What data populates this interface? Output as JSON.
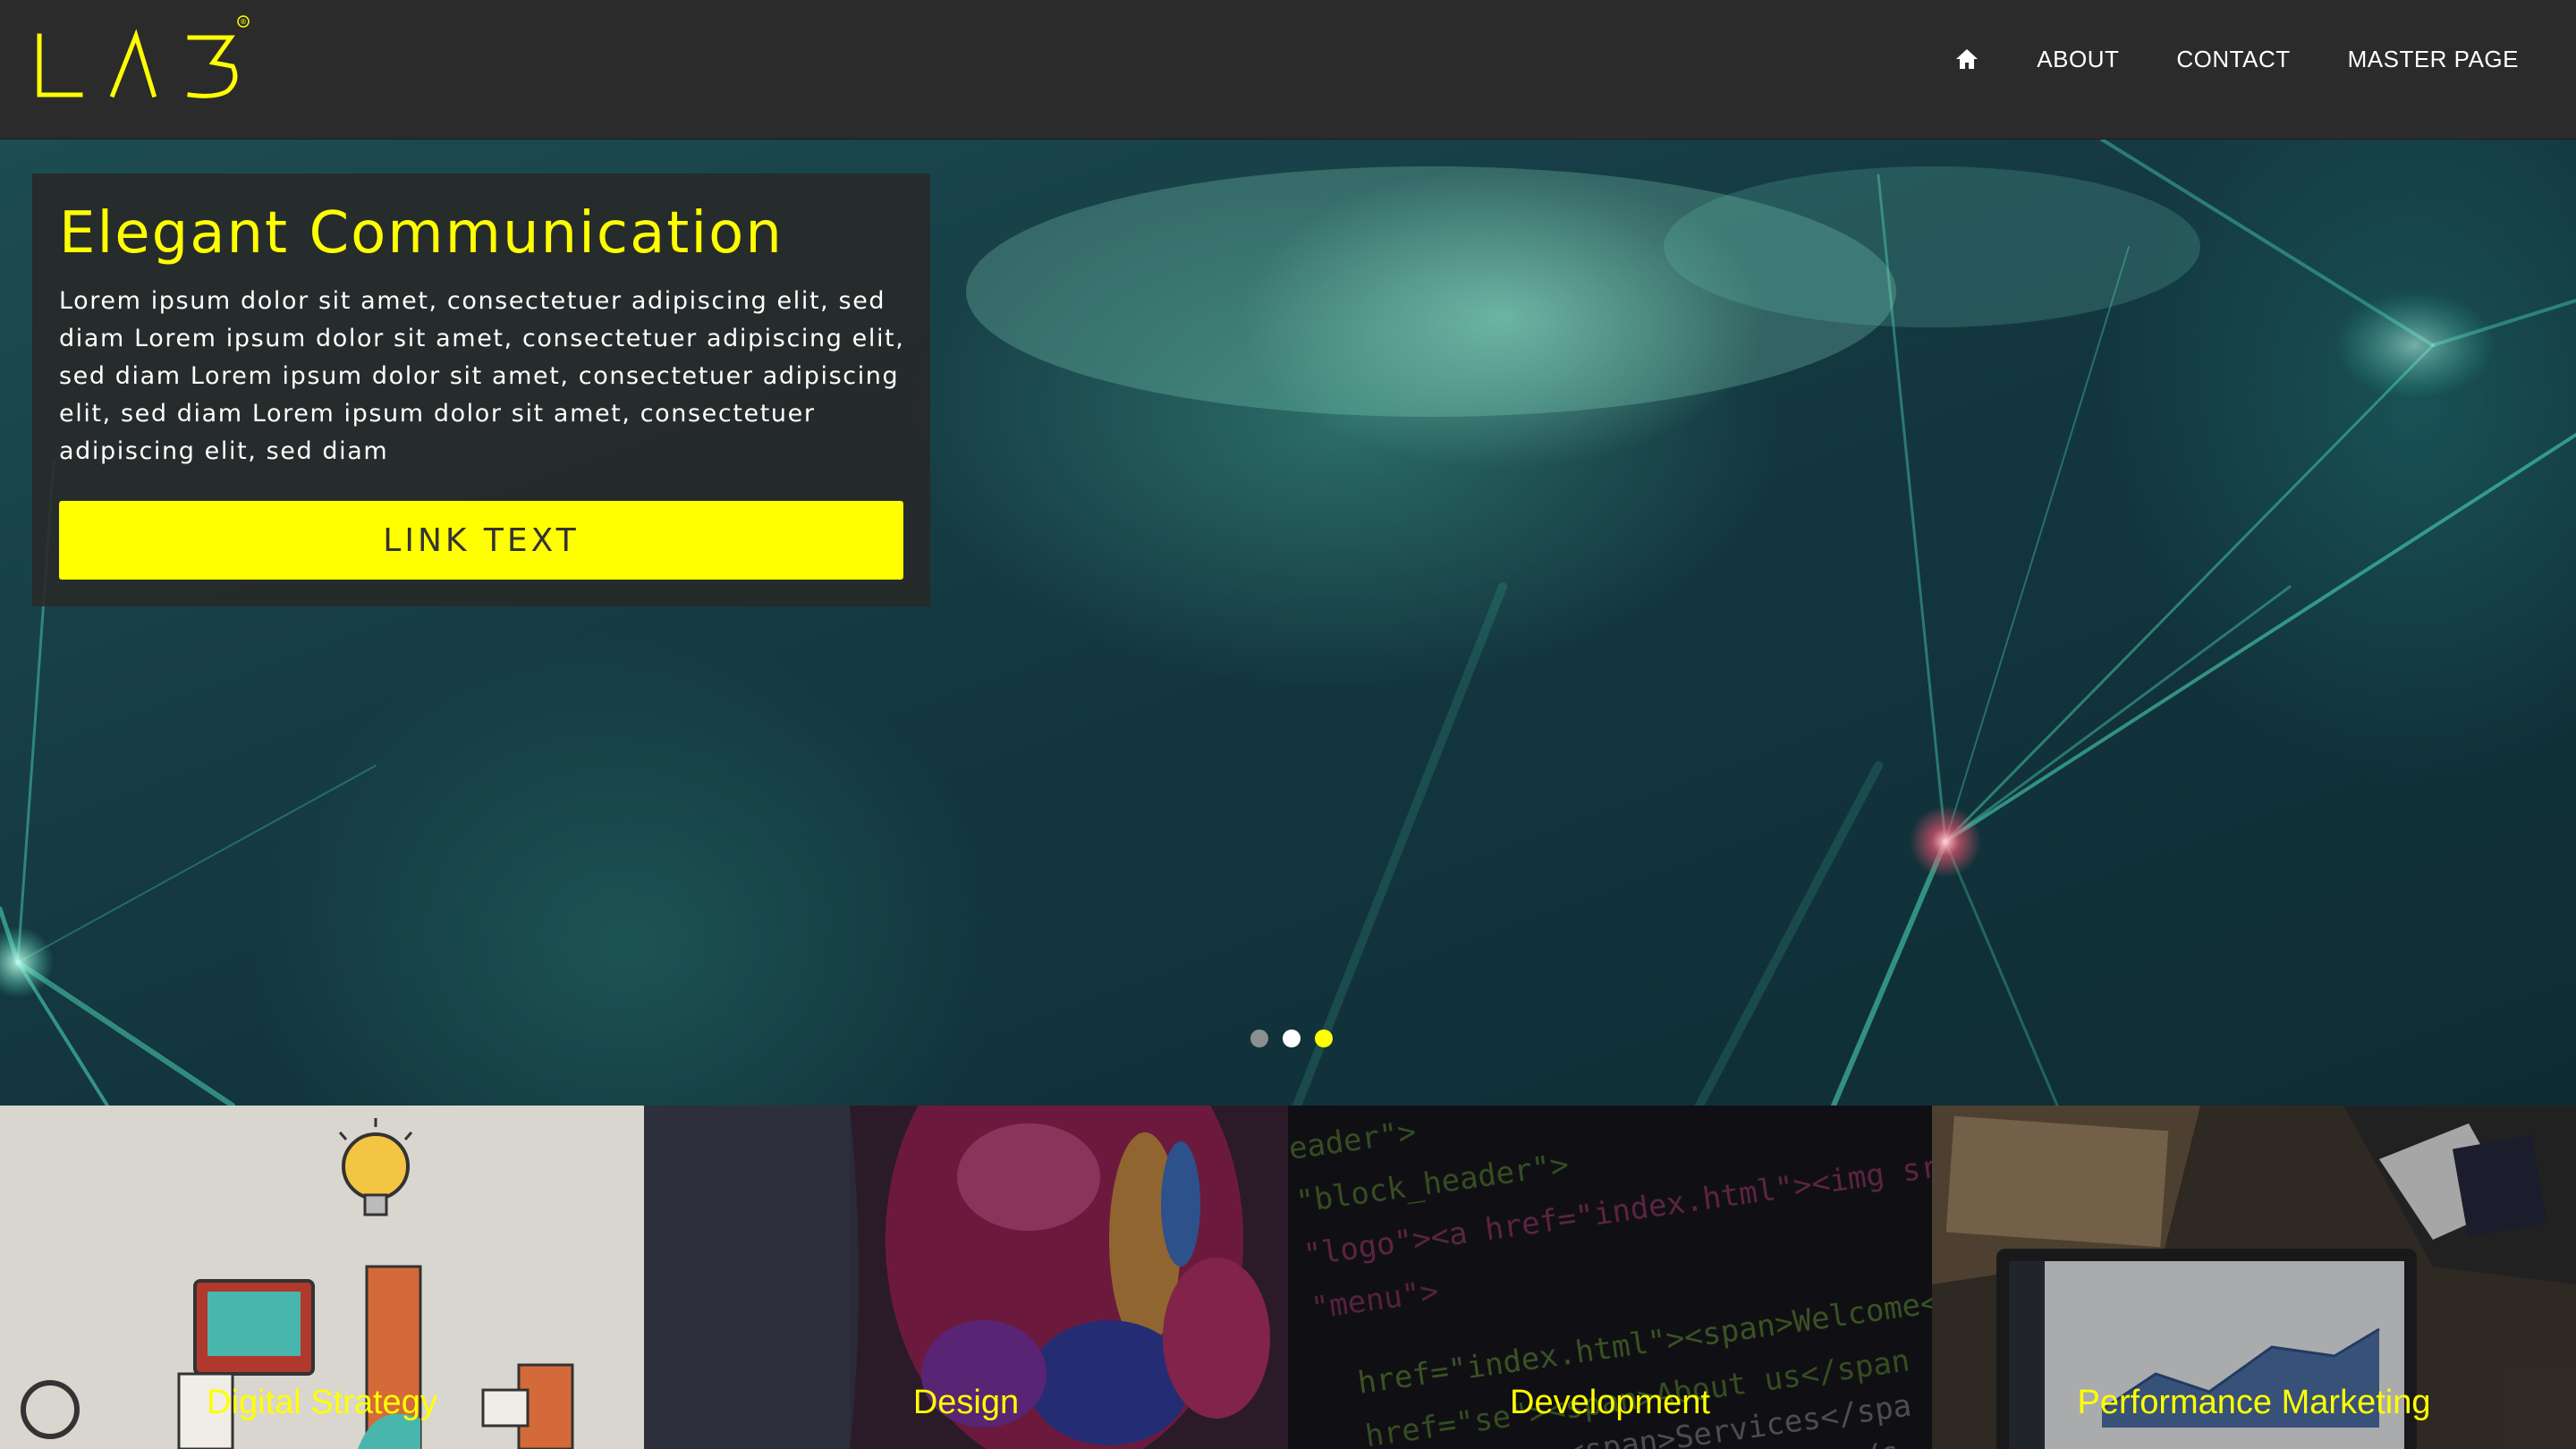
{
  "brand": {
    "logo_text": "LAB",
    "registered_mark": "®",
    "accent_color": "#ffff00"
  },
  "nav": {
    "home_icon": "home-icon",
    "items": [
      {
        "label": "ABOUT"
      },
      {
        "label": "CONTACT"
      },
      {
        "label": "MASTER PAGE"
      }
    ]
  },
  "hero": {
    "title": "Elegant Communication",
    "body": "Lorem ipsum dolor sit amet, consectetuer adipiscing elit, sed diam Lorem ipsum dolor sit amet, consectetuer adipiscing elit, sed diam Lorem ipsum dolor sit amet, consectetuer adipiscing elit, sed diam Lorem ipsum dolor sit amet, consectetuer adipiscing elit, sed diam",
    "button_label": "LINK TEXT",
    "slider": {
      "count": 3,
      "active_index": 2,
      "colors": [
        "#8a8f91",
        "#ffffff",
        "#ffff00"
      ]
    }
  },
  "tiles": [
    {
      "label": "Digital Strategy"
    },
    {
      "label": "Design"
    },
    {
      "label": "Development",
      "code_snippets": [
        "eader\">",
        "\"block_header\">",
        "\"logo\"><a href=\"index.html\"><img src=\"image",
        "\"menu\">",
        "href=\"index.html\"><span>Welcome</span></a",
        "href=\"se\"><span>About us</span",
        "<span>Services</spa",
        "<span>Portfolio</s"
      ]
    },
    {
      "label": "Performance Marketing"
    }
  ]
}
